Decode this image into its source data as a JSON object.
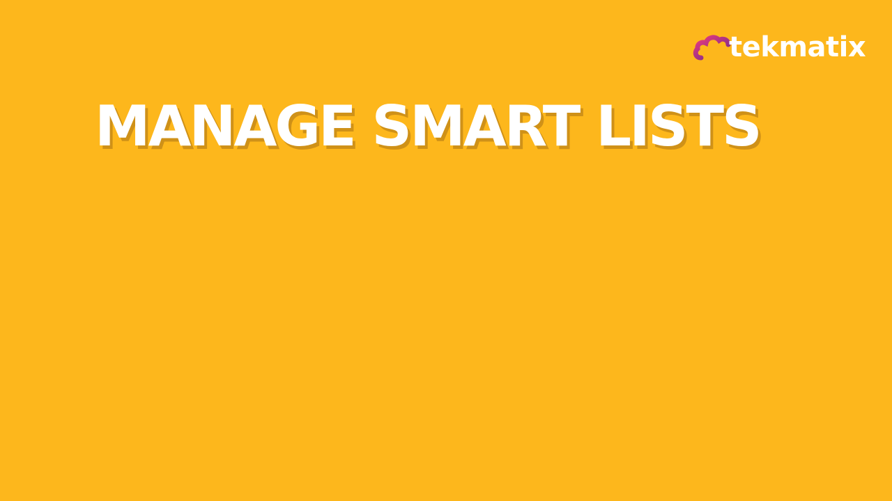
{
  "slide": {
    "background": "#FDB71C",
    "title": "MANAGE SMART LISTS"
  },
  "logo": {
    "icon": "cloud-logo-icon",
    "wordmark": "tekmatix",
    "gradient_start": "#EC3A7C",
    "gradient_end": "#6A2C8E",
    "text_color": "#FFFFFF"
  }
}
